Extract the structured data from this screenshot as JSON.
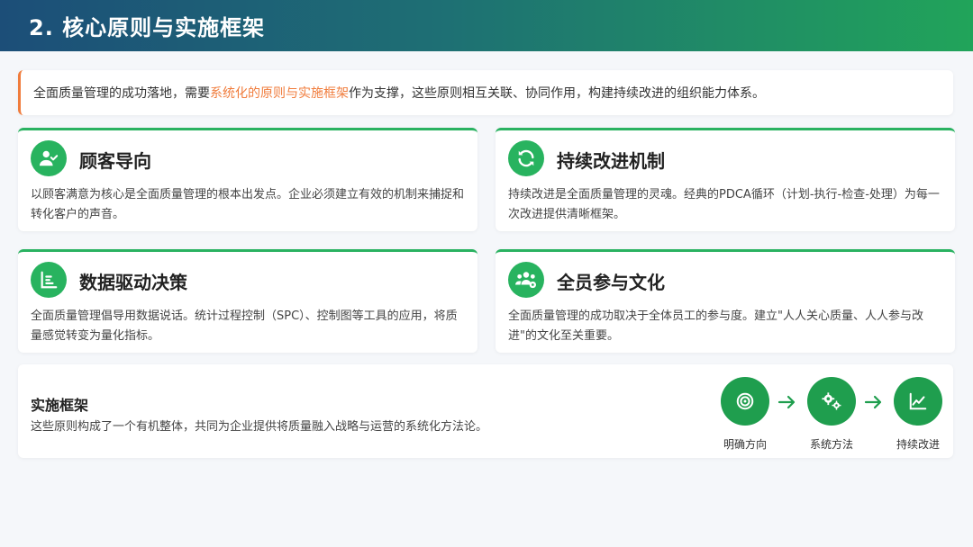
{
  "header": {
    "title": "2. 核心原则与实施框架"
  },
  "intro": {
    "before": "全面质量管理的成功落地，需要",
    "highlight": "系统化的原则与实施框架",
    "after": "作为支撑，这些原则相互关联、协同作用，构建持续改进的组织能力体系。"
  },
  "cards": [
    {
      "icon": "user-check-icon",
      "title": "顾客导向",
      "desc": "以顾客满意为核心是全面质量管理的根本出发点。企业必须建立有效的机制来捕捉和转化客户的声音。"
    },
    {
      "icon": "refresh-icon",
      "title": "持续改进机制",
      "desc": "持续改进是全面质量管理的灵魂。经典的PDCA循环（计划-执行-检查-处理）为每一次改进提供清晰框架。"
    },
    {
      "icon": "list-chart-icon",
      "title": "数据驱动决策",
      "desc": "全面质量管理倡导用数据说话。统计过程控制（SPC）、控制图等工具的应用，将质量感觉转变为量化指标。"
    },
    {
      "icon": "users-gear-icon",
      "title": "全员参与文化",
      "desc": "全面质量管理的成功取决于全体员工的参与度。建立\"人人关心质量、人人参与改进\"的文化至关重要。"
    }
  ],
  "framework": {
    "title": "实施框架",
    "desc": "这些原则构成了一个有机整体，共同为企业提供将质量融入战略与运营的系统化方法论。",
    "steps": [
      {
        "icon": "target-icon",
        "label": "明确方向"
      },
      {
        "icon": "gears-icon",
        "label": "系统方法"
      },
      {
        "icon": "trend-chart-icon",
        "label": "持续改进"
      }
    ]
  },
  "colors": {
    "accent": "#2ab261",
    "highlight": "#f07c3c",
    "header_start": "#1c4e78",
    "header_end": "#21a45a"
  }
}
